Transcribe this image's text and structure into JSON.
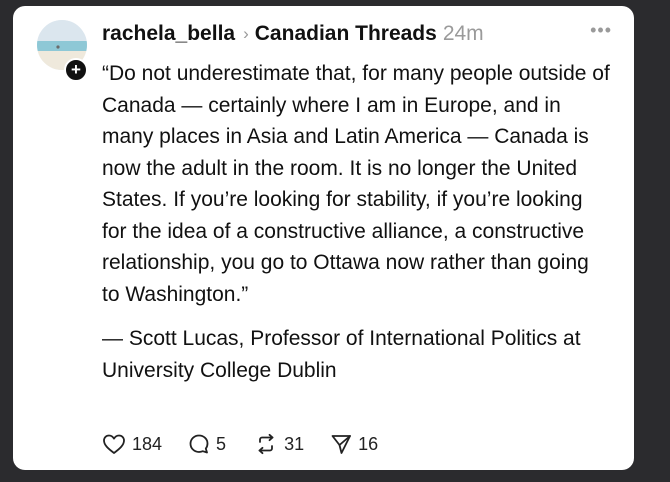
{
  "post": {
    "username": "rachela_bella",
    "separator_icon": "chevron-right-icon",
    "community": "Canadian Threads",
    "time": "24m",
    "more_icon": "more-icon",
    "follow_icon": "plus-icon",
    "quote": "“Do not underestimate that, for many people outside of Canada — certainly where I am in Europe, and in many places in Asia and Latin America — Canada is now the adult in the room. It is no longer the United States. If you’re looking for stability, if you’re looking for the idea of a constructive alliance, a constructive relationship, you go to Ottawa now rather than going to Washington.”",
    "attribution": "— Scott Lucas, Professor of International Politics at University College Dublin"
  },
  "actions": {
    "likes": "184",
    "replies": "5",
    "reposts": "31",
    "shares": "16"
  },
  "colors": {
    "background": "#2b2b2e",
    "card": "#ffffff",
    "text": "#111111",
    "muted": "#9a9a9a"
  }
}
